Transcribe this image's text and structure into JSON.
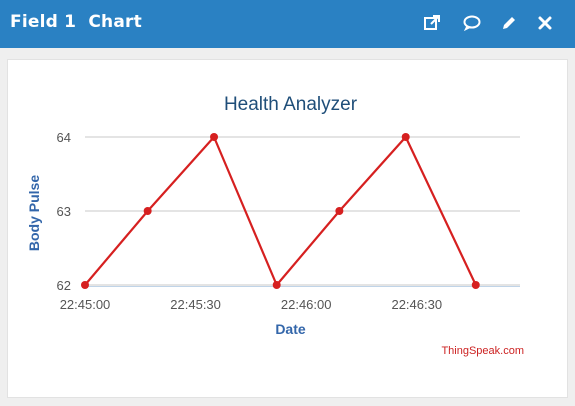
{
  "window": {
    "title": "Field 1  Chart",
    "icons": [
      "external-link-icon",
      "comment-icon",
      "pencil-icon",
      "close-icon"
    ]
  },
  "colors": {
    "header": "#2a81c3",
    "series": "#d62020",
    "title_text": "#1f4e79",
    "axis_title": "#3366aa",
    "credit": "#cc2222"
  },
  "chart_data": {
    "type": "line",
    "title": "Health Analyzer",
    "xlabel": "Date",
    "ylabel": "Body Pulse",
    "x_ticks": [
      "22:45:00",
      "22:45:30",
      "22:46:00",
      "22:46:30"
    ],
    "y_ticks": [
      62,
      63,
      64
    ],
    "ylim": [
      62,
      64
    ],
    "xlim": [
      "22:45:00",
      "22:46:58"
    ],
    "grid": true,
    "series": [
      {
        "x": [
          "22:45:00",
          "22:45:17",
          "22:45:35",
          "22:45:52",
          "22:46:09",
          "22:46:27",
          "22:46:46"
        ],
        "values": [
          62,
          63,
          64,
          62,
          63,
          64,
          62
        ]
      }
    ],
    "credit": "ThingSpeak.com"
  }
}
